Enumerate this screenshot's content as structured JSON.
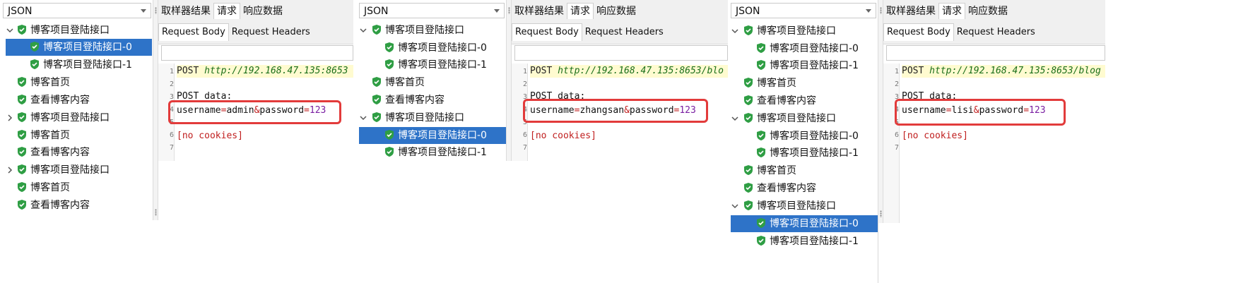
{
  "panels": [
    {
      "tree": {
        "dropdown": "JSON",
        "nodes": [
          {
            "label": "博客项目登陆接口"
          },
          {
            "label": "博客项目登陆接口-0"
          },
          {
            "label": "博客项目登陆接口-1"
          },
          {
            "label": "博客首页"
          },
          {
            "label": "查看博客内容"
          },
          {
            "label": "博客项目登陆接口"
          },
          {
            "label": "博客首页"
          },
          {
            "label": "查看博客内容"
          },
          {
            "label": "博客项目登陆接口"
          },
          {
            "label": "博客首页"
          },
          {
            "label": "查看博客内容"
          }
        ]
      },
      "tabs": [
        "取样器结果",
        "请求",
        "响应数据"
      ],
      "subtabs": [
        "Request Body",
        "Request Headers"
      ],
      "editor": {
        "line_numbers": [
          "1",
          "2",
          "3",
          "4",
          "5",
          "6",
          "7"
        ],
        "method": "POST",
        "url": "http://192.168.47.135:8653",
        "post_label": "POST data:",
        "body_user_key": "username",
        "eq": "=",
        "user": "admin",
        "amp": "&",
        "body_pass_key": "password",
        "pass": "123",
        "no_cookies": "[no cookies]"
      }
    },
    {
      "tree": {
        "dropdown": "JSON",
        "nodes": [
          {
            "label": "博客项目登陆接口"
          },
          {
            "label": "博客项目登陆接口-0"
          },
          {
            "label": "博客项目登陆接口-1"
          },
          {
            "label": "博客首页"
          },
          {
            "label": "查看博客内容"
          },
          {
            "label": "博客项目登陆接口"
          },
          {
            "label": "博客项目登陆接口-0"
          },
          {
            "label": "博客项目登陆接口-1"
          }
        ]
      },
      "tabs": [
        "取样器结果",
        "请求",
        "响应数据"
      ],
      "subtabs": [
        "Request Body",
        "Request Headers"
      ],
      "editor": {
        "line_numbers": [
          "1",
          "2",
          "3",
          "4",
          "5",
          "6",
          "7"
        ],
        "method": "POST",
        "url": "http://192.168.47.135:8653/blo",
        "post_label": "POST data:",
        "body_user_key": "username",
        "eq": "=",
        "user": "zhangsan",
        "amp": "&",
        "body_pass_key": "password",
        "pass": "123",
        "no_cookies": "[no cookies]"
      }
    },
    {
      "tree": {
        "dropdown": "JSON",
        "nodes": [
          {
            "label": "博客项目登陆接口"
          },
          {
            "label": "博客项目登陆接口-0"
          },
          {
            "label": "博客项目登陆接口-1"
          },
          {
            "label": "博客首页"
          },
          {
            "label": "查看博客内容"
          },
          {
            "label": "博客项目登陆接口"
          },
          {
            "label": "博客项目登陆接口-0"
          },
          {
            "label": "博客项目登陆接口-1"
          },
          {
            "label": "博客首页"
          },
          {
            "label": "查看博客内容"
          },
          {
            "label": "博客项目登陆接口"
          },
          {
            "label": "博客项目登陆接口-0"
          },
          {
            "label": "博客项目登陆接口-1"
          }
        ]
      },
      "tabs": [
        "取样器结果",
        "请求",
        "响应数据"
      ],
      "subtabs": [
        "Request Body",
        "Request Headers"
      ],
      "editor": {
        "line_numbers": [
          "1",
          "2",
          "3",
          "4",
          "5",
          "6",
          "7"
        ],
        "method": "POST",
        "url": "http://192.168.47.135:8653/blog",
        "post_label": "POST data:",
        "body_user_key": "username",
        "eq": "=",
        "user": "lisi",
        "amp": "&",
        "body_pass_key": "password",
        "pass": "123",
        "no_cookies": "[no cookies]"
      }
    }
  ],
  "colors": {
    "selected": "#2e73c8",
    "shield": "#2f9e44",
    "highlight_box": "#e23b3b"
  }
}
